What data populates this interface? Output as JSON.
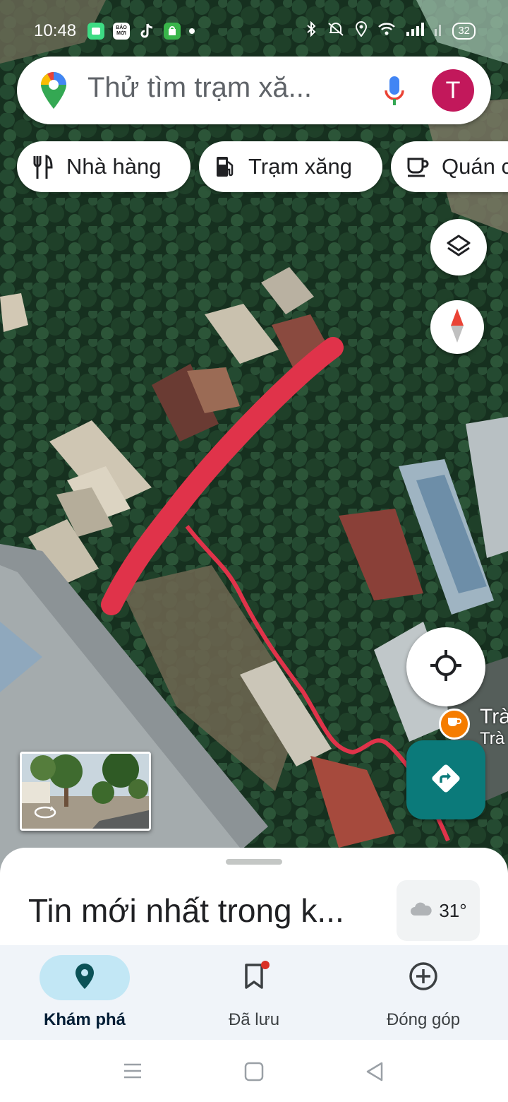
{
  "status_bar": {
    "time": "10:48",
    "app_icons": [
      "app-icon",
      "bao-moi-icon",
      "tiktok-icon",
      "store-icon"
    ],
    "bao_moi_label": "BÁO MỚI",
    "battery": "32"
  },
  "search": {
    "placeholder": "Thử tìm trạm xă..."
  },
  "account": {
    "initial": "T",
    "color": "#c2185b"
  },
  "chips": [
    {
      "label": "Nhà hàng",
      "icon": "restaurant-icon"
    },
    {
      "label": "Trạm xăng",
      "icon": "gas-station-icon"
    },
    {
      "label": "Quán c",
      "icon": "coffee-icon"
    }
  ],
  "map": {
    "poi": {
      "line1": "Trà",
      "line2": "Trà",
      "icon": "coffee-icon"
    },
    "annotation_color": "#e0334a"
  },
  "sheet": {
    "title": "Tin mới nhất trong k...",
    "weather": {
      "temp": "31°",
      "icon": "cloud-icon"
    }
  },
  "nav": [
    {
      "label": "Khám phá",
      "icon": "explore-pin-icon",
      "active": true
    },
    {
      "label": "Đã lưu",
      "icon": "bookmark-icon",
      "active": false,
      "badge": true
    },
    {
      "label": "Đóng góp",
      "icon": "add-circle-icon",
      "active": false
    }
  ],
  "system_nav": [
    "menu-icon",
    "home-icon",
    "back-icon"
  ]
}
